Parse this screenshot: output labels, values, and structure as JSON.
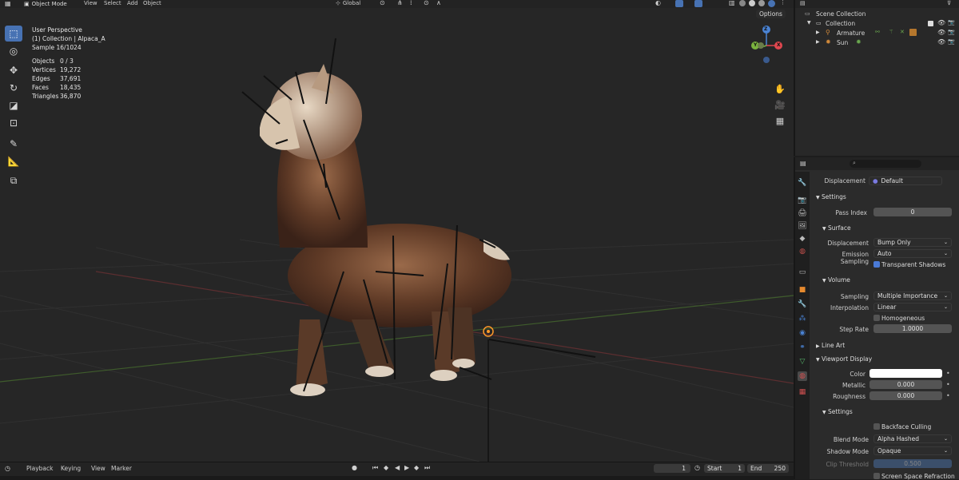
{
  "header": {
    "mode": "Object Mode",
    "menus": [
      "View",
      "Select",
      "Add",
      "Object"
    ],
    "orientation": "Global",
    "options_label": "Options"
  },
  "viewport": {
    "perspective": "User Perspective",
    "collection_object": "(1) Collection | Alpaca_A",
    "sample": "Sample 16/1024",
    "stats": [
      {
        "label": "Objects",
        "value": "0 / 3"
      },
      {
        "label": "Vertices",
        "value": "19,272"
      },
      {
        "label": "Edges",
        "value": "37,691"
      },
      {
        "label": "Faces",
        "value": "18,435"
      },
      {
        "label": "Triangles",
        "value": "36,870"
      }
    ],
    "gizmo": {
      "x": "X",
      "y": "Y",
      "z": "Z"
    }
  },
  "outliner": {
    "root": "Scene Collection",
    "collection": "Collection",
    "items": [
      "Armature",
      "Sun"
    ]
  },
  "properties": {
    "displacement_label": "Displacement",
    "displacement_value": "Default",
    "settings_header": "Settings",
    "pass_index_label": "Pass Index",
    "pass_index_value": "0",
    "surface_header": "Surface",
    "surface_displacement_label": "Displacement",
    "surface_displacement_value": "Bump Only",
    "emission_sampling_label": "Emission Sampling",
    "emission_sampling_value": "Auto",
    "transparent_shadows_label": "Transparent Shadows",
    "volume_header": "Volume",
    "sampling_label": "Sampling",
    "sampling_value": "Multiple Importance",
    "interpolation_label": "Interpolation",
    "interpolation_value": "Linear",
    "homogeneous_label": "Homogeneous",
    "step_rate_label": "Step Rate",
    "step_rate_value": "1.0000",
    "line_art_header": "Line Art",
    "viewport_display_header": "Viewport Display",
    "color_label": "Color",
    "color_value": "#ffffff",
    "metallic_label": "Metallic",
    "metallic_value": "0.000",
    "roughness_label": "Roughness",
    "roughness_value": "0.000",
    "vd_settings_header": "Settings",
    "backface_culling_label": "Backface Culling",
    "blend_mode_label": "Blend Mode",
    "blend_mode_value": "Alpha Hashed",
    "shadow_mode_label": "Shadow Mode",
    "shadow_mode_value": "Opaque",
    "clip_threshold_label": "Clip Threshold",
    "clip_threshold_value": "0.500",
    "screen_space_refraction_label": "Screen Space Refraction"
  },
  "timeline": {
    "menus": [
      "Playback",
      "Keying",
      "View",
      "Marker"
    ],
    "current_frame": "1",
    "start_label": "Start",
    "start_value": "1",
    "end_label": "End",
    "end_value": "250"
  },
  "colors": {
    "accent": "#4772b3",
    "x_axis": "#e0474f",
    "y_axis": "#7ab33e",
    "z_axis": "#4a83d4"
  }
}
